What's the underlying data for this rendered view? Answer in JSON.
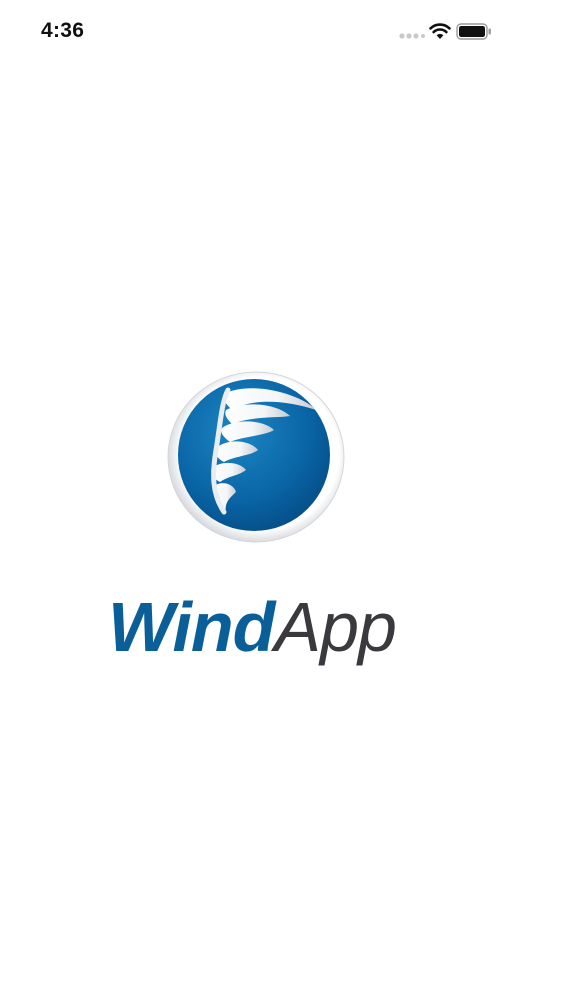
{
  "status_bar": {
    "time": "4:36",
    "signal_icon": "cellular-signal-icon",
    "wifi_icon": "wifi-icon",
    "battery_icon": "battery-icon"
  },
  "splash": {
    "logo_icon": "tornado-logo-icon",
    "wordmark_bold": "Wind",
    "wordmark_light": "App",
    "colors": {
      "brand_blue": "#0b5f98",
      "wordmark_gray": "#3a3a3e",
      "background": "#ffffff"
    }
  }
}
